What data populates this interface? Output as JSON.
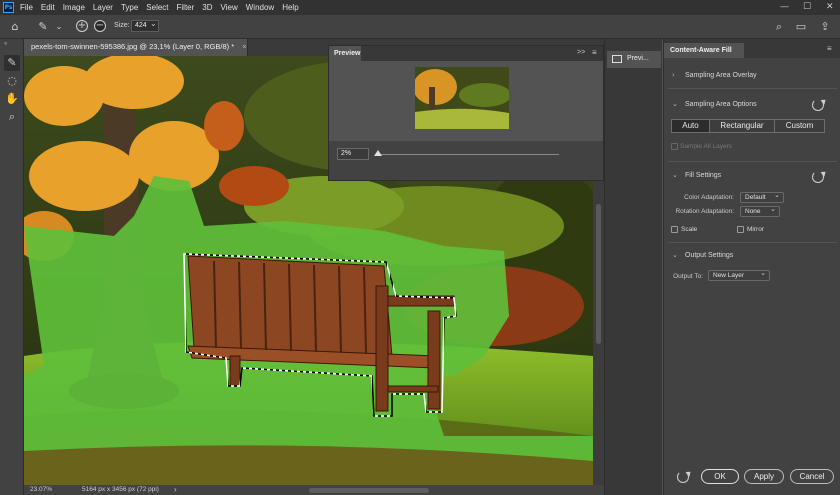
{
  "app": {
    "logo": "Ps"
  },
  "menu": [
    "File",
    "Edit",
    "Image",
    "Layer",
    "Type",
    "Select",
    "Filter",
    "3D",
    "View",
    "Window",
    "Help"
  ],
  "window_controls": {
    "minimize": "—",
    "maximize": "☐",
    "close": "✕"
  },
  "options_bar": {
    "size_label": "Size:",
    "size_value": "424"
  },
  "document": {
    "tab_title": "pexels-tom-swinnen-595386.jpg @ 23,1% (Layer 0, RGB/8) *",
    "tab_close": "×"
  },
  "status": {
    "zoom": "23.07%",
    "dimensions": "5164 px x 3456 px (72 ppi)",
    "arrow": "›"
  },
  "preview_panel": {
    "title": "Preview",
    "zoom_value": "2%",
    "expand": ">>",
    "menu": "≡"
  },
  "collapsed_panel": {
    "label": "Previ..."
  },
  "caf_panel": {
    "title": "Content-Aware Fill",
    "sections": {
      "sampling_overlay": "Sampling Area Overlay",
      "sampling_options": "Sampling Area Options",
      "fill_settings": "Fill Settings",
      "output_settings": "Output Settings"
    },
    "sampling_modes": [
      "Auto",
      "Rectangular",
      "Custom"
    ],
    "sample_all_layers": "Sample All Layers",
    "color_adaptation_label": "Color Adaptation:",
    "color_adaptation_value": "Default",
    "rotation_adaptation_label": "Rotation Adaptation:",
    "rotation_adaptation_value": "None",
    "scale_label": "Scale",
    "mirror_label": "Mirror",
    "output_label": "Output To:",
    "output_value": "New Layer",
    "buttons": {
      "ok": "OK",
      "apply": "Apply",
      "cancel": "Cancel"
    }
  },
  "colors": {
    "accent_green": "#5fbf3a",
    "panel_bg": "#424242",
    "app_bg": "#535353"
  }
}
